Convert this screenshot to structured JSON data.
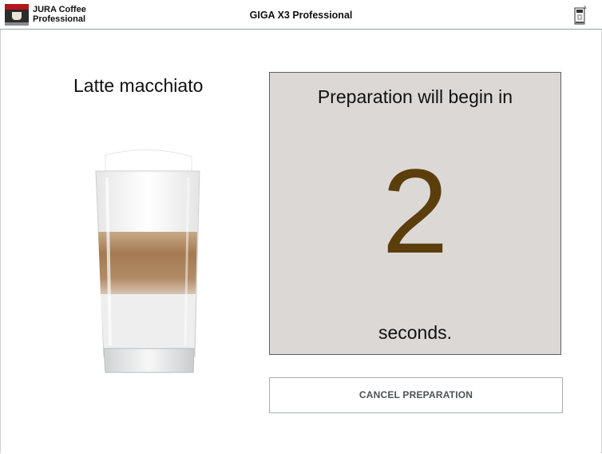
{
  "header": {
    "app_name": "JURA Coffee Professional",
    "window_title": "GIGA X3 Professional",
    "logo_icon": "jura-logo-icon",
    "machine_icon": "coffee-machine-icon"
  },
  "product": {
    "name": "Latte macchiato",
    "image_icon": "latte-macchiato-glass-icon"
  },
  "countdown": {
    "heading": "Preparation will begin in",
    "value": "2",
    "unit": "seconds."
  },
  "actions": {
    "cancel_label": "CANCEL PREPARATION"
  },
  "colors": {
    "panel_bg": "#dcd8d5",
    "countdown_number": "#5c3d0c",
    "button_text": "#4d5257"
  }
}
